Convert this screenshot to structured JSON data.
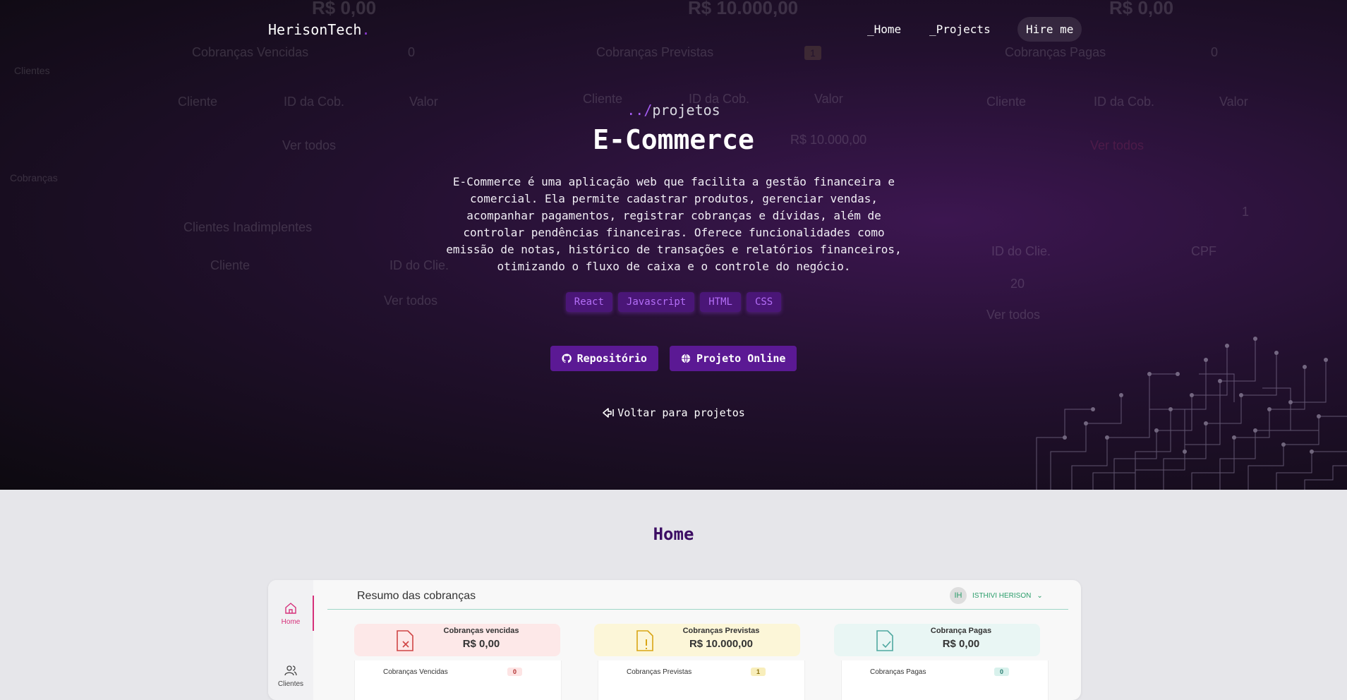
{
  "navbar": {
    "brand": "HerisonTech",
    "brand_dot": ".",
    "links": [
      "_Home",
      "_Projects",
      "Hire me"
    ]
  },
  "hero": {
    "breadcrumb_accent": "../",
    "breadcrumb_rest": "projetos",
    "title": "E-Commerce",
    "description": "E-Commerce é uma aplicação web que facilita a gestão financeira e comercial. Ela permite cadastrar produtos, gerenciar vendas, acompanhar pagamentos, registrar cobranças e dívidas, além de controlar pendências financeiras. Oferece funcionalidades como emissão de notas, histórico de transações e relatórios financeiros, otimizando o fluxo de caixa e o controle do negócio.",
    "tags": [
      "React",
      "Javascript",
      "HTML",
      "CSS"
    ],
    "repo_button": "Repositório",
    "live_button": "Projeto Online",
    "back_link": "Voltar para projetos"
  },
  "background_ghost": {
    "amount_1": "R$ 0,00",
    "amount_2": "R$ 10.000,00",
    "amount_3": "R$ 0,00",
    "label_1": "Cobranças Vencidas",
    "label_2": "Cobranças Previstas",
    "label_3": "Cobranças Pagas",
    "count_1": "0",
    "count_2": "1",
    "count_3": "0",
    "col_cliente": "Cliente",
    "col_id_cob": "ID da Cob.",
    "col_valor": "Valor",
    "ver_todos": "Ver todos",
    "inadimplentes": "Clientes Inadimplentes",
    "col_id_clie": "ID do Clie.",
    "col_cpf": "CPF",
    "row_valor": "R$ 10.000,00",
    "row_id": "20",
    "sidebar_clientes": "Clientes",
    "sidebar_cobrancas": "Cobranças"
  },
  "section": {
    "title": "Home"
  },
  "preview": {
    "sidebar": [
      {
        "label": "Home",
        "icon": "home-icon"
      },
      {
        "label": "Clientes",
        "icon": "users-icon"
      }
    ],
    "heading": "Resumo das cobranças",
    "user_initials": "IH",
    "user_name": "ISTHIVI HERISON",
    "cards": [
      {
        "label": "Cobranças vencidas",
        "value": "R$ 0,00",
        "color": "#fde8e8"
      },
      {
        "label": "Cobranças Previstas",
        "value": "R$ 10.000,00",
        "color": "#fcf6d8"
      },
      {
        "label": "Cobrança Pagas",
        "value": "R$ 0,00",
        "color": "#e9f6f4"
      }
    ],
    "subcards": [
      {
        "label": "Cobranças Vencidas",
        "count": "0"
      },
      {
        "label": "Cobranças Previstas",
        "count": "1"
      },
      {
        "label": "Cobranças Pagas",
        "count": "0"
      }
    ]
  },
  "colors": {
    "accent_purple": "#5b1994",
    "tag_text": "#b46ef8",
    "section_title": "#3c0d63",
    "preview_accent": "#d6307a"
  }
}
